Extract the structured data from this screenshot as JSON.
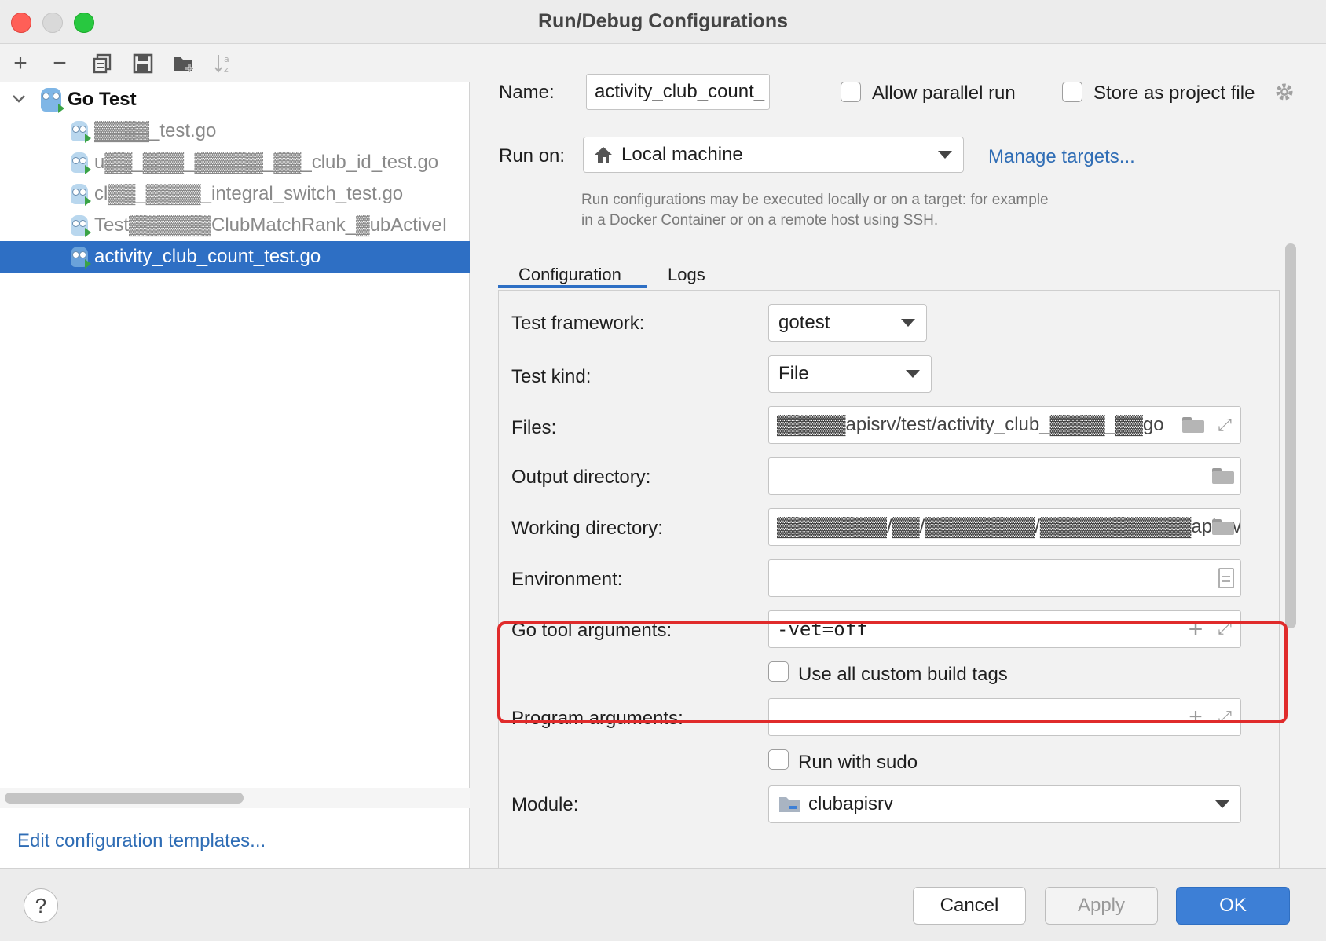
{
  "window": {
    "title": "Run/Debug Configurations"
  },
  "toolbar": {
    "icons": [
      "add-icon",
      "remove-icon",
      "copy-icon",
      "save-icon",
      "new-folder-icon",
      "sort-icon"
    ]
  },
  "tree": {
    "group_label": "Go Test",
    "items": [
      {
        "label": "▓▓▓▓_test.go",
        "selected": false
      },
      {
        "label": "u▓▓_▓▓▓_▓▓▓▓▓_▓▓_club_id_test.go",
        "selected": false
      },
      {
        "label": "cl▓▓_▓▓▓▓_integral_switch_test.go",
        "selected": false
      },
      {
        "label": "Test▓▓▓▓▓▓ClubMatchRank_▓ubActiveI",
        "selected": false
      },
      {
        "label": "activity_club_count_test.go",
        "selected": true
      }
    ]
  },
  "left_footer": {
    "edit_templates": "Edit configuration templates..."
  },
  "form": {
    "name_label": "Name:",
    "name_value": "activity_club_count_",
    "allow_parallel_label": "Allow parallel run",
    "store_project_label": "Store as project file",
    "run_on_label": "Run on:",
    "run_on_value": "Local machine",
    "manage_targets": "Manage targets...",
    "hint_line1": "Run configurations may be executed locally or on a target: for example",
    "hint_line2": "in a Docker Container or on a remote host using SSH."
  },
  "tabs": [
    {
      "label": "Configuration",
      "active": true
    },
    {
      "label": "Logs",
      "active": false
    }
  ],
  "config": {
    "test_framework_label": "Test framework:",
    "test_framework_value": "gotest",
    "test_kind_label": "Test kind:",
    "test_kind_value": "File",
    "files_label": "Files:",
    "files_value": "▓▓▓▓▓apisrv/test/activity_club_▓▓▓▓_▓▓go",
    "output_dir_label": "Output directory:",
    "output_dir_value": "",
    "working_dir_label": "Working directory:",
    "working_dir_value": "▓▓▓▓▓▓▓▓/▓▓/▓▓▓▓▓▓▓▓/▓▓▓▓▓▓▓▓▓▓▓apisrv/test",
    "environment_label": "Environment:",
    "environment_value": "",
    "go_tool_args_label": "Go tool arguments:",
    "go_tool_args_value": "-vet=off",
    "custom_build_tags_label": "Use all custom build tags",
    "program_args_label": "Program arguments:",
    "program_args_value": "",
    "run_sudo_label": "Run with sudo",
    "module_label": "Module:",
    "module_value": "clubapisrv"
  },
  "buttons": {
    "help": "?",
    "cancel": "Cancel",
    "apply": "Apply",
    "ok": "OK"
  },
  "colors": {
    "accent": "#2e6fc4",
    "highlight_box": "#e02b2b",
    "link": "#2f6db5"
  }
}
